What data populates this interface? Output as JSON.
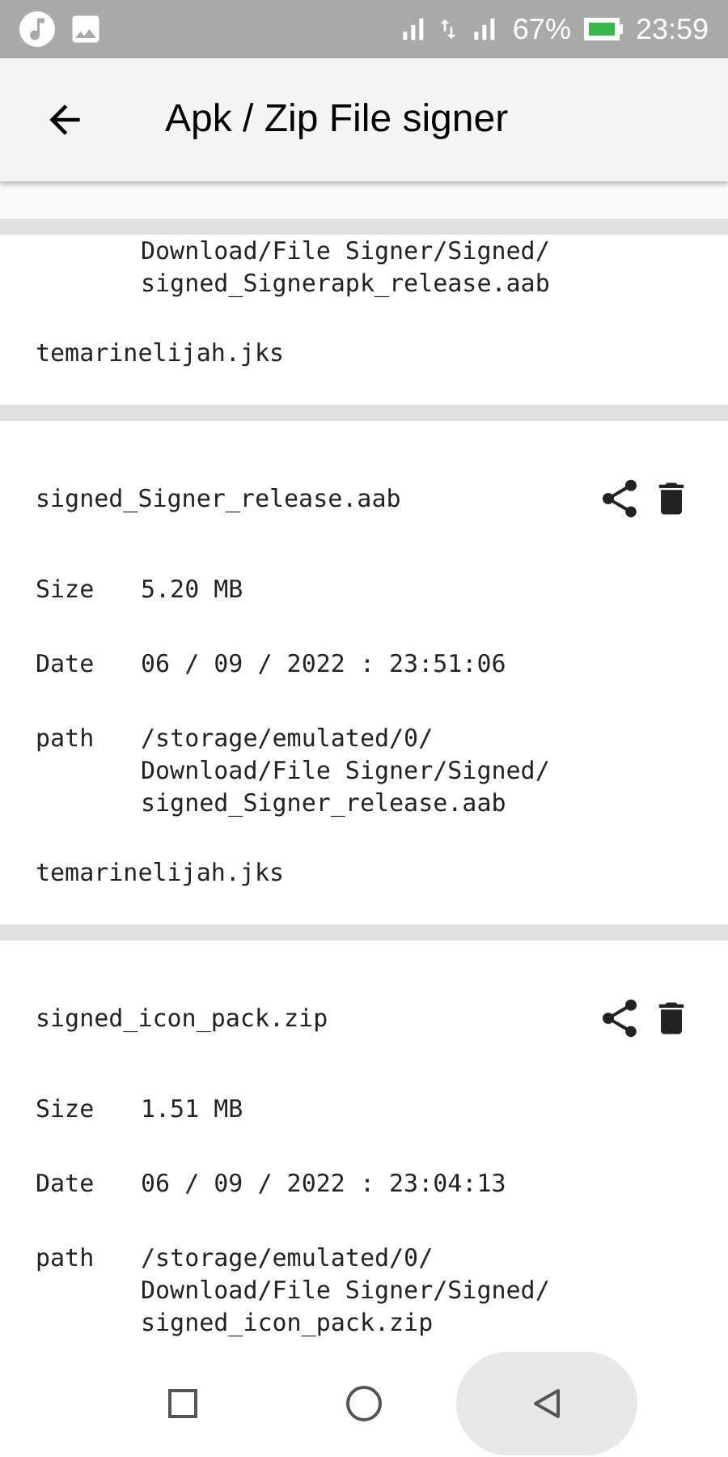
{
  "status_bar": {
    "battery": "67%",
    "time": "23:59"
  },
  "app_bar": {
    "title": "Apk / Zip File signer"
  },
  "files": [
    {
      "details": [
        {
          "value_lines": [
            "Download/File Signer/Signed/",
            "signed_Signerapk_release.aab"
          ]
        }
      ],
      "keystore": "temarinelijah.jks"
    },
    {
      "name": "signed_Signer_release.aab",
      "details": [
        {
          "label": "Size",
          "value_lines": [
            "5.20 MB"
          ]
        },
        {
          "label": "Date",
          "value_lines": [
            "06 / 09 / 2022 : 23:51:06"
          ]
        },
        {
          "label": "path",
          "value_lines": [
            "/storage/emulated/0/",
            "Download/File Signer/Signed/",
            "signed_Signer_release.aab"
          ]
        }
      ],
      "keystore": "temarinelijah.jks"
    },
    {
      "name": "signed_icon_pack.zip",
      "details": [
        {
          "label": "Size",
          "value_lines": [
            "1.51 MB"
          ]
        },
        {
          "label": "Date",
          "value_lines": [
            "06 / 09 / 2022 : 23:04:13"
          ]
        },
        {
          "label": "path",
          "value_lines": [
            "/storage/emulated/0/",
            "Download/File Signer/Signed/",
            "signed_icon_pack.zip"
          ]
        }
      ]
    }
  ]
}
